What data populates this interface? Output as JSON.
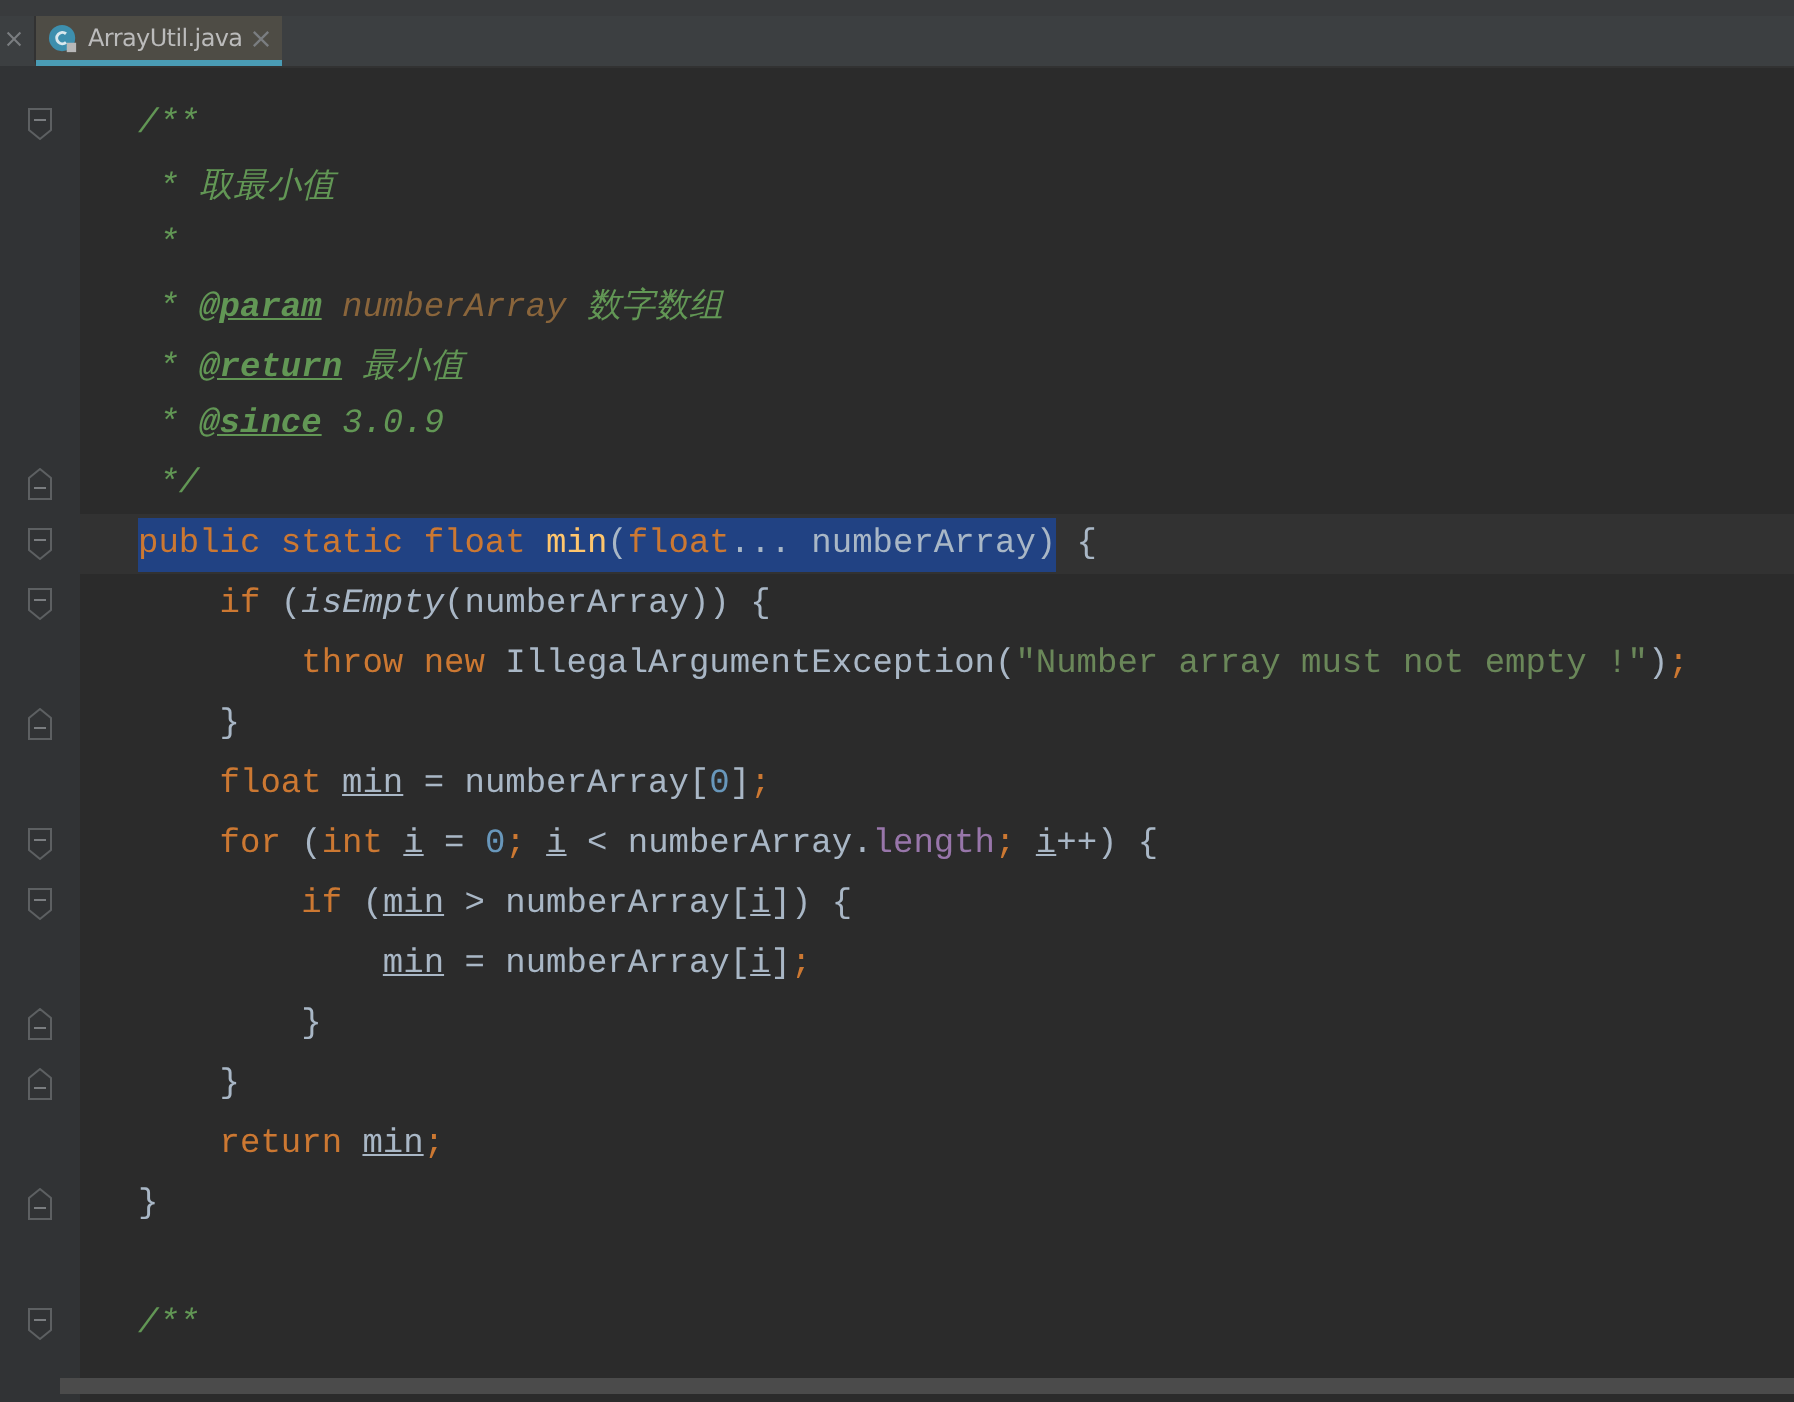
{
  "tabs": [
    {
      "cut_off": true,
      "selected": false
    },
    {
      "label": "ArrayUtil.java",
      "selected": true
    }
  ],
  "lines": [
    {
      "kind": "fold-start",
      "tokens": [
        {
          "kind": "comment",
          "t": "/**"
        }
      ]
    },
    {
      "kind": "plain",
      "tokens": [
        {
          "kind": "comment",
          "t": " * 取最小值"
        }
      ]
    },
    {
      "kind": "plain",
      "tokens": [
        {
          "kind": "comment",
          "t": " *"
        }
      ]
    },
    {
      "kind": "plain",
      "tokens": [
        {
          "kind": "comment",
          "t": " * "
        },
        {
          "kind": "doctag",
          "t": "@param"
        },
        {
          "kind": "docparam",
          "t": " numberArray"
        },
        {
          "kind": "comment",
          "t": " 数字数组"
        }
      ]
    },
    {
      "kind": "plain",
      "tokens": [
        {
          "kind": "comment",
          "t": " * "
        },
        {
          "kind": "doctag",
          "t": "@return"
        },
        {
          "kind": "comment",
          "t": " 最小值"
        }
      ]
    },
    {
      "kind": "plain",
      "tokens": [
        {
          "kind": "comment",
          "t": " * "
        },
        {
          "kind": "doctag",
          "t": "@since"
        },
        {
          "kind": "comment",
          "t": " 3.0.9"
        }
      ]
    },
    {
      "kind": "fold-end",
      "tokens": [
        {
          "kind": "comment",
          "t": " */"
        }
      ]
    },
    {
      "kind": "fold-start",
      "current": true,
      "selected_tokens": [
        {
          "kind": "keyword",
          "t": "public static float "
        },
        {
          "kind": "method",
          "t": "min"
        },
        {
          "kind": "plain",
          "t": "("
        },
        {
          "kind": "keyword",
          "t": "float"
        },
        {
          "kind": "plain",
          "t": "... numberArray)"
        }
      ],
      "tokens": [
        {
          "kind": "plain",
          "t": " {"
        }
      ]
    },
    {
      "kind": "fold-start",
      "tokens": [
        {
          "kind": "keyword",
          "t": "    if"
        },
        {
          "kind": "plain",
          "t": " ("
        },
        {
          "kind": "call",
          "t": "isEmpty"
        },
        {
          "kind": "plain",
          "t": "(numberArray)) {"
        }
      ]
    },
    {
      "kind": "plain",
      "tokens": [
        {
          "kind": "keyword",
          "t": "        throw new "
        },
        {
          "kind": "plain",
          "t": "IllegalArgumentException("
        },
        {
          "kind": "string",
          "t": "\"Number array must not empty !\""
        },
        {
          "kind": "plain",
          "t": ")"
        },
        {
          "kind": "keyword",
          "t": ";"
        }
      ]
    },
    {
      "kind": "fold-end",
      "tokens": [
        {
          "kind": "plain",
          "t": "    }"
        }
      ]
    },
    {
      "kind": "plain",
      "tokens": [
        {
          "kind": "keyword",
          "t": "    float "
        },
        {
          "kind": "var",
          "t": "min"
        },
        {
          "kind": "plain",
          "t": " = numberArray["
        },
        {
          "kind": "number",
          "t": "0"
        },
        {
          "kind": "plain",
          "t": "]"
        },
        {
          "kind": "keyword",
          "t": ";"
        }
      ]
    },
    {
      "kind": "fold-start",
      "tokens": [
        {
          "kind": "keyword",
          "t": "    for"
        },
        {
          "kind": "plain",
          "t": " ("
        },
        {
          "kind": "keyword",
          "t": "int "
        },
        {
          "kind": "var",
          "t": "i"
        },
        {
          "kind": "plain",
          "t": " = "
        },
        {
          "kind": "number",
          "t": "0"
        },
        {
          "kind": "keyword",
          "t": "; "
        },
        {
          "kind": "var",
          "t": "i"
        },
        {
          "kind": "plain",
          "t": " < numberArray."
        },
        {
          "kind": "field",
          "t": "length"
        },
        {
          "kind": "keyword",
          "t": "; "
        },
        {
          "kind": "var",
          "t": "i"
        },
        {
          "kind": "plain",
          "t": "++) {"
        }
      ]
    },
    {
      "kind": "fold-start",
      "tokens": [
        {
          "kind": "keyword",
          "t": "        if"
        },
        {
          "kind": "plain",
          "t": " ("
        },
        {
          "kind": "var",
          "t": "min"
        },
        {
          "kind": "plain",
          "t": " > numberArray["
        },
        {
          "kind": "var",
          "t": "i"
        },
        {
          "kind": "plain",
          "t": "]) {"
        }
      ]
    },
    {
      "kind": "plain",
      "tokens": [
        {
          "kind": "var",
          "t": "            min"
        },
        {
          "kind": "plain",
          "t": " = numberArray["
        },
        {
          "kind": "var",
          "t": "i"
        },
        {
          "kind": "plain",
          "t": "]"
        },
        {
          "kind": "keyword",
          "t": ";"
        }
      ]
    },
    {
      "kind": "fold-end",
      "tokens": [
        {
          "kind": "plain",
          "t": "        }"
        }
      ]
    },
    {
      "kind": "fold-end",
      "tokens": [
        {
          "kind": "plain",
          "t": "    }"
        }
      ]
    },
    {
      "kind": "plain",
      "tokens": [
        {
          "kind": "keyword",
          "t": "    return "
        },
        {
          "kind": "var",
          "t": "min"
        },
        {
          "kind": "keyword",
          "t": ";"
        }
      ]
    },
    {
      "kind": "fold-end",
      "tokens": [
        {
          "kind": "plain",
          "t": "}"
        }
      ]
    },
    {
      "kind": "plain"
    },
    {
      "kind": "fold-start",
      "tokens": [
        {
          "kind": "comment",
          "t": "/**"
        }
      ]
    }
  ]
}
